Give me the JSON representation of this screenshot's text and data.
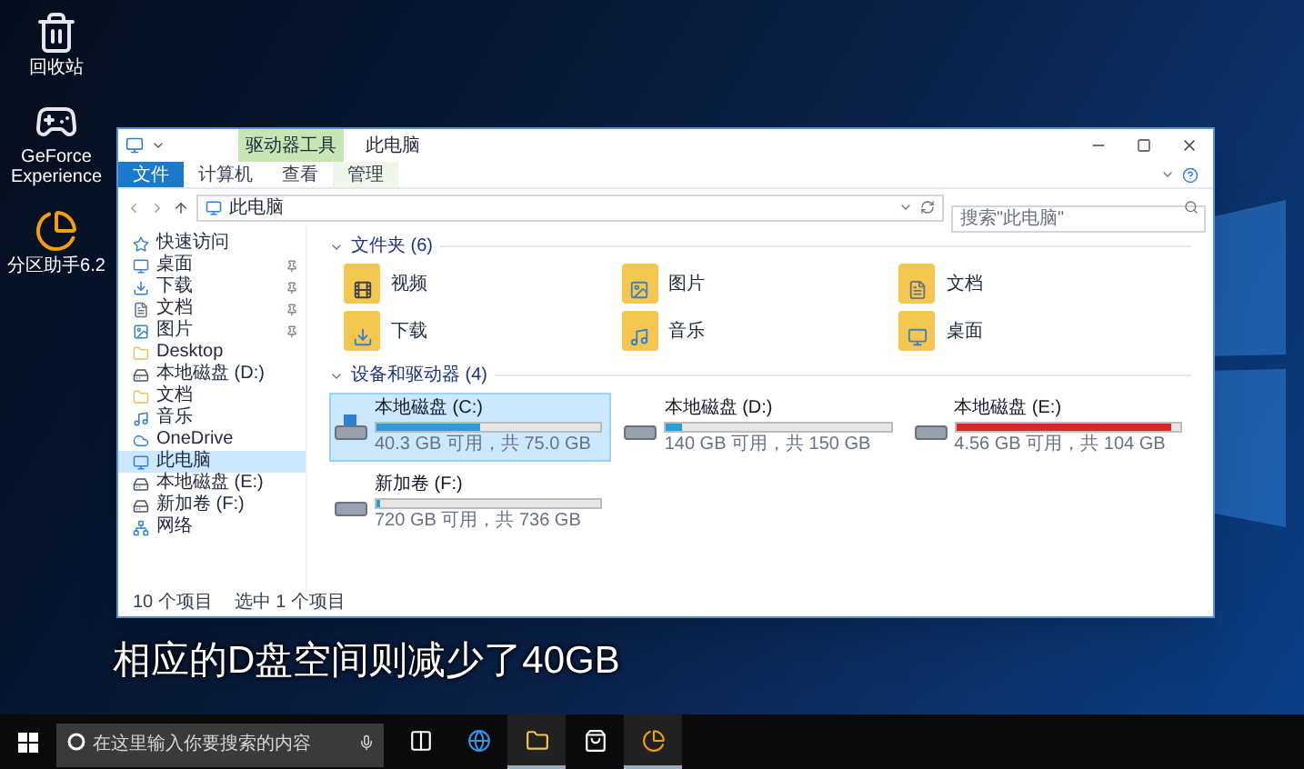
{
  "desktop_icons": [
    {
      "label": "回收站",
      "kind": "trash"
    },
    {
      "label": "GeForce Experience",
      "kind": "app"
    },
    {
      "label": "分区助手6.2",
      "kind": "tool"
    }
  ],
  "window": {
    "title": "此电脑",
    "context_tab": "驱动器工具",
    "ribbon_tabs": [
      {
        "label": "文件",
        "kind": "file"
      },
      {
        "label": "计算机",
        "kind": "tab"
      },
      {
        "label": "查看",
        "kind": "tab"
      },
      {
        "label": "管理",
        "kind": "context"
      }
    ],
    "address": "此电脑",
    "search": {
      "placeholder": "搜索\"此电脑\""
    }
  },
  "nav": [
    {
      "label": "快速访问",
      "kind": "star",
      "pinned": false,
      "selected": false
    },
    {
      "label": "桌面",
      "kind": "desktop",
      "pinned": true,
      "selected": false
    },
    {
      "label": "下载",
      "kind": "download",
      "pinned": true,
      "selected": false
    },
    {
      "label": "文档",
      "kind": "document",
      "pinned": true,
      "selected": false
    },
    {
      "label": "图片",
      "kind": "picture",
      "pinned": true,
      "selected": false
    },
    {
      "label": "Desktop",
      "kind": "folder",
      "pinned": false,
      "selected": false
    },
    {
      "label": "本地磁盘 (D:)",
      "kind": "drive",
      "pinned": false,
      "selected": false
    },
    {
      "label": "文档",
      "kind": "folder",
      "pinned": false,
      "selected": false
    },
    {
      "label": "音乐",
      "kind": "music",
      "pinned": false,
      "selected": false
    },
    {
      "label": "OneDrive",
      "kind": "cloud",
      "pinned": false,
      "selected": false
    },
    {
      "label": "此电脑",
      "kind": "pc",
      "pinned": false,
      "selected": true
    },
    {
      "label": "本地磁盘 (E:)",
      "kind": "drive",
      "pinned": false,
      "selected": false
    },
    {
      "label": "新加卷 (F:)",
      "kind": "drive",
      "pinned": false,
      "selected": false
    },
    {
      "label": "网络",
      "kind": "network",
      "pinned": false,
      "selected": false
    }
  ],
  "folders": {
    "title": "文件夹 (6)",
    "items": [
      {
        "label": "视频",
        "kind": "video"
      },
      {
        "label": "图片",
        "kind": "picture"
      },
      {
        "label": "文档",
        "kind": "document"
      },
      {
        "label": "下载",
        "kind": "download"
      },
      {
        "label": "音乐",
        "kind": "music"
      },
      {
        "label": "桌面",
        "kind": "desktop"
      }
    ]
  },
  "drives": {
    "title": "设备和驱动器 (4)",
    "items": [
      {
        "name": "本地磁盘 (C:)",
        "kind": "system",
        "level": 0.46,
        "reading": "40.3 GB 可用，共 75.0 GB",
        "selected": true,
        "color": "#26a0da"
      },
      {
        "name": "本地磁盘 (D:)",
        "kind": "disk",
        "level": 0.07,
        "reading": "140 GB 可用，共 150 GB",
        "selected": false,
        "color": "#26a0da"
      },
      {
        "name": "本地磁盘 (E:)",
        "kind": "disk",
        "level": 0.96,
        "reading": "4.56 GB 可用，共 104 GB",
        "selected": false,
        "color": "#da2626"
      },
      {
        "name": "新加卷 (F:)",
        "kind": "disk",
        "level": 0.02,
        "reading": "720 GB 可用，共 736 GB",
        "selected": false,
        "color": "#26a0da"
      }
    ]
  },
  "status_bar": [
    "10 个项目",
    "选中 1 个项目"
  ],
  "subtitle": "相应的D盘空间则减少了40GB",
  "taskbar": {
    "search": {
      "placeholder": "在这里输入你要搜索的内容"
    },
    "apps": [
      {
        "kind": "taskview",
        "active": false
      },
      {
        "kind": "edge",
        "active": false
      },
      {
        "kind": "explorer",
        "active": true
      },
      {
        "kind": "store",
        "active": false
      },
      {
        "kind": "partition",
        "active": true
      }
    ]
  }
}
